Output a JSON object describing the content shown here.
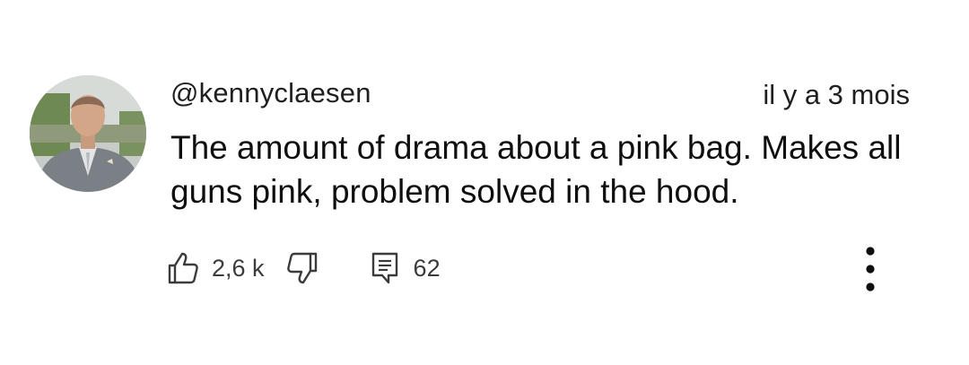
{
  "comment": {
    "author": "@kennyclaesen",
    "timestamp": "il y a 3 mois",
    "text": "The amount of drama about a pink bag. Makes all guns pink, problem solved in the hood.",
    "avatar_icon": "profile-photo",
    "likes": "2,6 k",
    "replies": "62"
  },
  "icons": {
    "like": "thumbs-up-icon",
    "dislike": "thumbs-down-icon",
    "reply": "comment-icon",
    "more": "more-vertical-icon"
  },
  "colors": {
    "text": "#0f0f0f",
    "secondary": "#3b3b3b",
    "background": "#ffffff"
  }
}
